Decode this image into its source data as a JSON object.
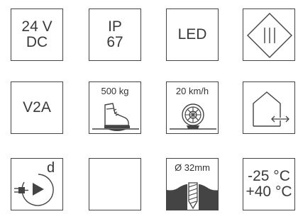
{
  "tiles": {
    "voltage": {
      "line1": "24 V",
      "line2": "DC"
    },
    "ip": {
      "line1": "IP",
      "line2": "67"
    },
    "led": {
      "label": "LED"
    },
    "steel": {
      "label": "V2A"
    },
    "load": {
      "label": "500 kg",
      "icon": "boot-icon"
    },
    "speed": {
      "label": "20 km/h",
      "icon": "wheel-icon"
    },
    "drill": {
      "label": "Ø 32mm",
      "icon": "drill-bit-icon"
    },
    "temperature": {
      "line1": "-25 °C",
      "line2": "+40 °C"
    },
    "protection_class": {
      "icon": "class-ii-diamond-icon"
    },
    "mounting": {
      "icon": "house-wall-mount-icon"
    },
    "connection": {
      "label": "d",
      "icon": "plug-play-icon"
    },
    "empty": {}
  },
  "colors": {
    "stroke": "#444444",
    "text": "#333333",
    "background": "#ffffff"
  }
}
